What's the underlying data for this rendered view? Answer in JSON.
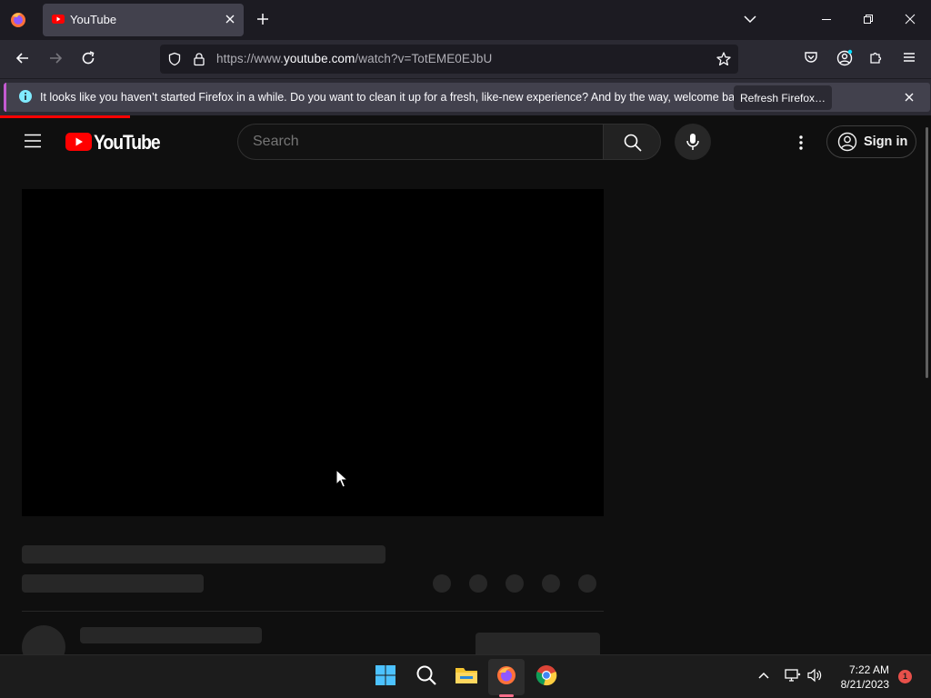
{
  "browser": {
    "tab_title": "YouTube",
    "url_prefix": "https://www.",
    "url_host": "youtube.com",
    "url_path": "/watch?v=TotEME0EJbU",
    "notification_message": "It looks like you haven’t started Firefox in a while. Do you want to clean it up for a fresh, like-new experience? And by the way, welcome back!",
    "refresh_button_label": "Refresh Firefox…"
  },
  "youtube": {
    "logo_text": "YouTube",
    "search_placeholder": "Search",
    "signin_label": "Sign in"
  },
  "taskbar": {
    "time": "7:22 AM",
    "date": "8/21/2023",
    "notification_count": "1"
  },
  "colors": {
    "youtube_red": "#ff0000",
    "page_bg": "#0f0f0f",
    "skeleton": "#272727",
    "browser_chrome": "#1c1b22"
  }
}
